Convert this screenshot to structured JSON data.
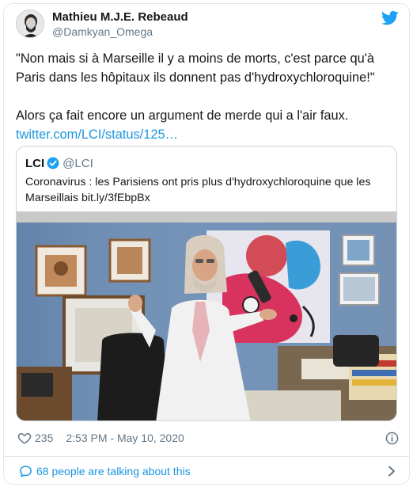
{
  "author": {
    "name": "Mathieu M.J.E. Rebeaud",
    "handle": "@Damkyan_Omega"
  },
  "icons": {
    "brand": "twitter-bird-icon",
    "verified": "verified-badge-icon",
    "like": "heart-icon",
    "info": "info-icon",
    "talk": "speech-bubble-icon",
    "more": "chevron-right-icon"
  },
  "colors": {
    "link": "#1b95e0",
    "text": "#14171a",
    "muted": "#657786",
    "border": "#e1e8ed"
  },
  "tweet": {
    "line1": "\"Non mais si à Marseille il y a moins de morts, c'est parce qu'à",
    "line2": "Paris dans les hôpitaux ils donnent pas d'hydroxychloroquine!\"",
    "line3": "Alors ça fait encore un argument de merde qui a l'air faux.",
    "link": "twitter.com/LCI/status/125…"
  },
  "quoted": {
    "name": "LCI",
    "handle": "@LCI",
    "text_line1": "Coronavirus : les Parisiens ont pris plus d'hydroxychloroquine que les",
    "text_line2": "Marseillais bit.ly/3fEbpBx"
  },
  "meta": {
    "likes": "235",
    "timestamp": "2:53 PM - May 10, 2020"
  },
  "footer": {
    "talking": "68 people are talking about this"
  }
}
